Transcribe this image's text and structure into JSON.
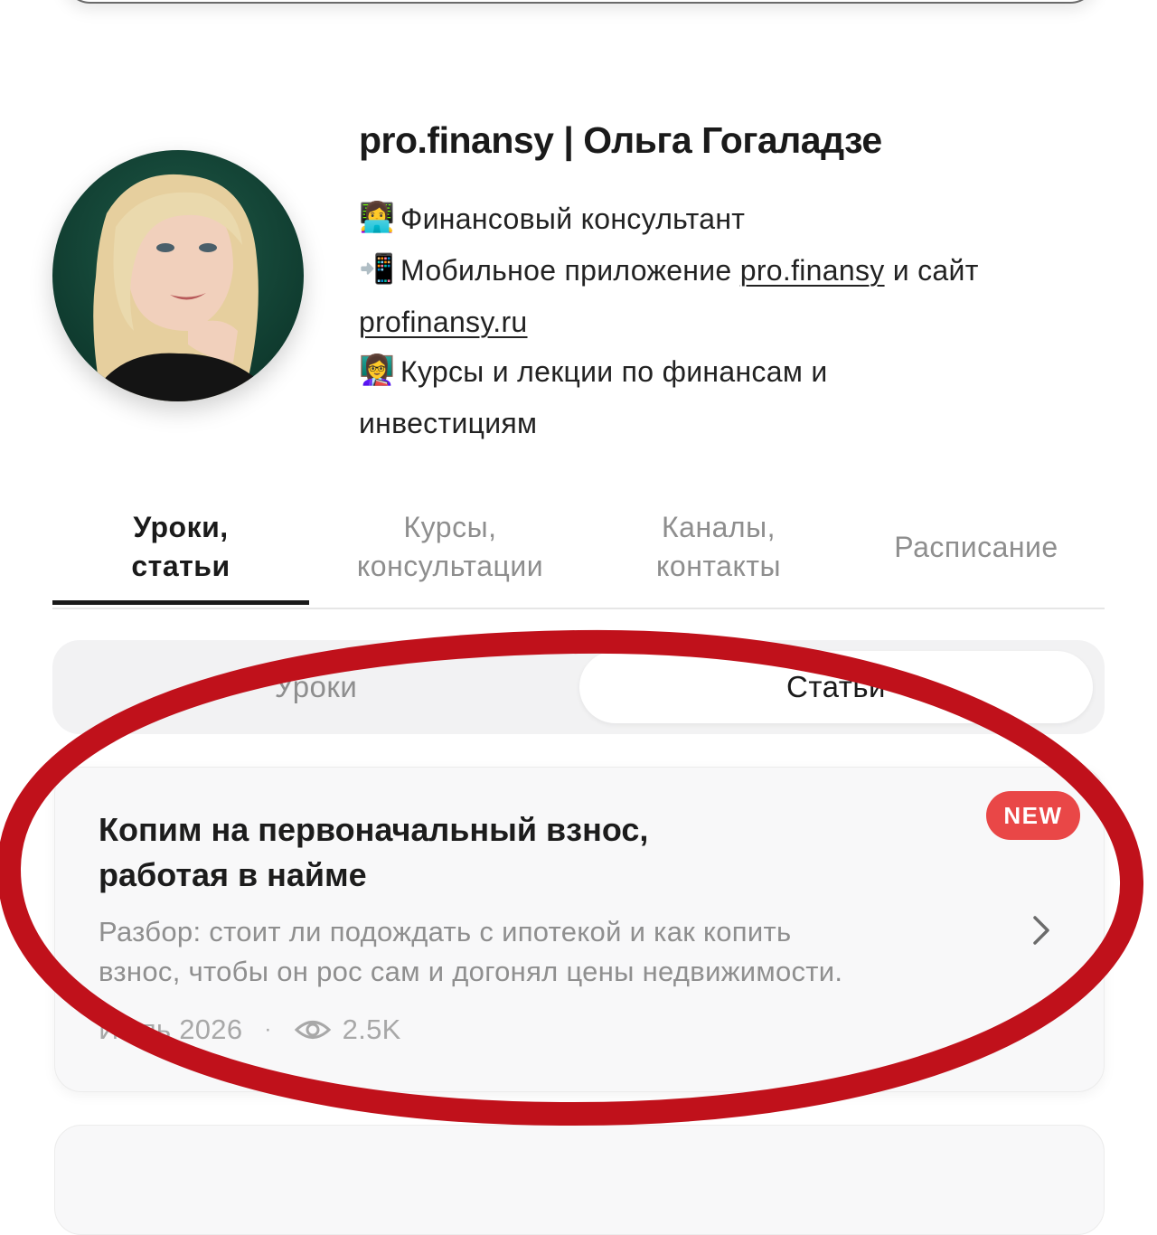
{
  "profile": {
    "name": "pro.finansy | Ольга Гогаладзе",
    "bio": [
      {
        "emoji": "👩‍💻",
        "text": "Финансовый консультант"
      },
      {
        "emoji": "📲",
        "text_before": "Мобильное приложение ",
        "link1": "pro.finansy",
        "text_after": " и сайт",
        "link2": "profinansy.ru"
      },
      {
        "emoji": "👩‍🏫",
        "text": "Курсы и лекции по финансам и",
        "text_line2": "инвестициям"
      }
    ]
  },
  "tabs": [
    {
      "label_line1": "Уроки,",
      "label_line2": "статьи",
      "active": true
    },
    {
      "label_line1": "Курсы,",
      "label_line2": "консультации",
      "active": false
    },
    {
      "label_line1": "Каналы,",
      "label_line2": "контакты",
      "active": false
    },
    {
      "label_line1": "Расписание",
      "label_line2": "",
      "active": false
    }
  ],
  "segment": {
    "options": [
      "Уроки",
      "Статьи"
    ],
    "selected": "Статьи"
  },
  "article": {
    "badge": "NEW",
    "title_line1": "Копим на первоначальный взнос,",
    "title_line2": "работая в найме",
    "desc_line1": "Разбор: стоит ли подождать с ипотекой и как копить",
    "desc_line2": "взнос, чтобы он рос сам и догонял цены недвижимости.",
    "date": "Июль 2026",
    "separator": "·",
    "views": "2.5K",
    "icons": {
      "views": "eye-icon",
      "open": "chevron-right-icon"
    }
  },
  "colors": {
    "badge": "#e94747",
    "annotation_ring": "#c0111b",
    "active_tab": "#1a1a1a",
    "muted_text": "#8f8f8f"
  }
}
